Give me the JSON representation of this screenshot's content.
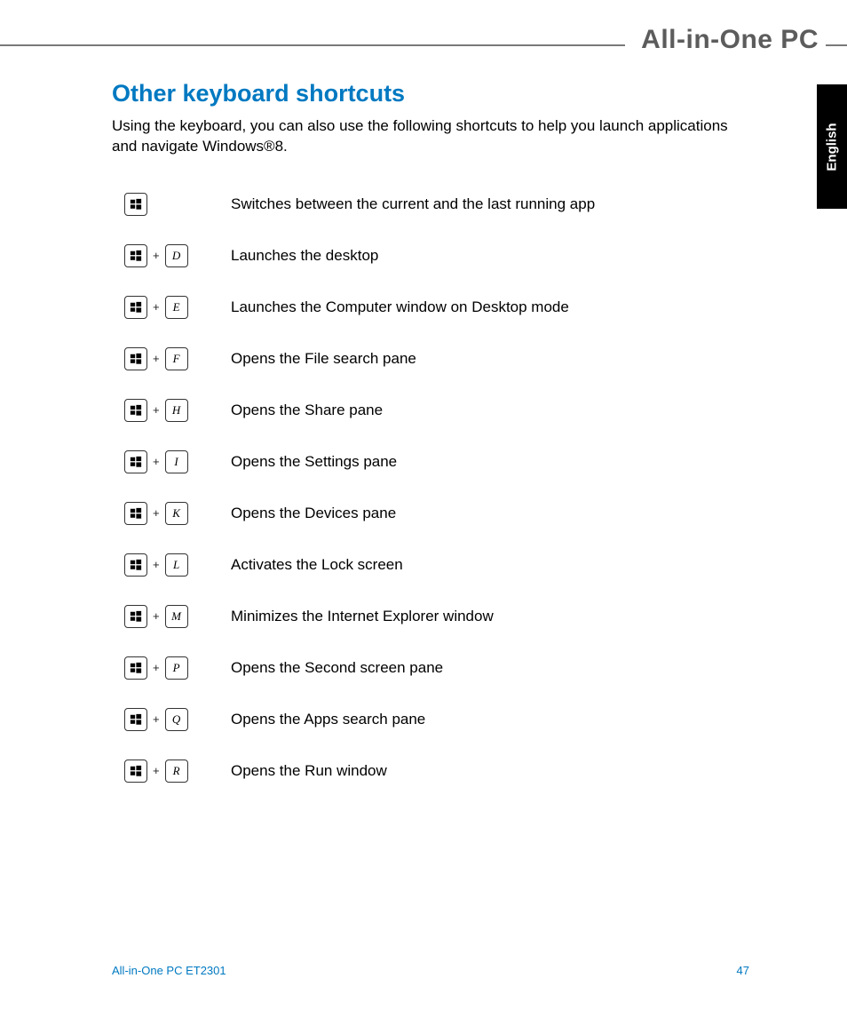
{
  "brand": "All-in-One PC",
  "side_tab": "English",
  "heading": "Other keyboard shortcuts",
  "intro": "Using the keyboard, you can also use the following shortcuts to help you launch applications and navigate Windows®8.",
  "shortcuts": [
    {
      "combo_key": "",
      "desc": "Switches between the current and the last running app"
    },
    {
      "combo_key": "D",
      "desc": "Launches the desktop"
    },
    {
      "combo_key": "E",
      "desc": "Launches the Computer window on Desktop mode"
    },
    {
      "combo_key": "F",
      "desc": "Opens the File search pane"
    },
    {
      "combo_key": "H",
      "desc": "Opens the Share pane"
    },
    {
      "combo_key": "I",
      "desc": "Opens the Settings pane"
    },
    {
      "combo_key": "K",
      "desc": "Opens the Devices pane"
    },
    {
      "combo_key": "L",
      "desc": "Activates the Lock screen"
    },
    {
      "combo_key": "M",
      "desc": "Minimizes the Internet Explorer window"
    },
    {
      "combo_key": "P",
      "desc": "Opens the Second screen pane"
    },
    {
      "combo_key": "Q",
      "desc": "Opens the Apps search pane"
    },
    {
      "combo_key": "R",
      "desc": "Opens the Run window"
    }
  ],
  "footer": {
    "model": "All-in-One PC ET2301",
    "page": "47"
  }
}
